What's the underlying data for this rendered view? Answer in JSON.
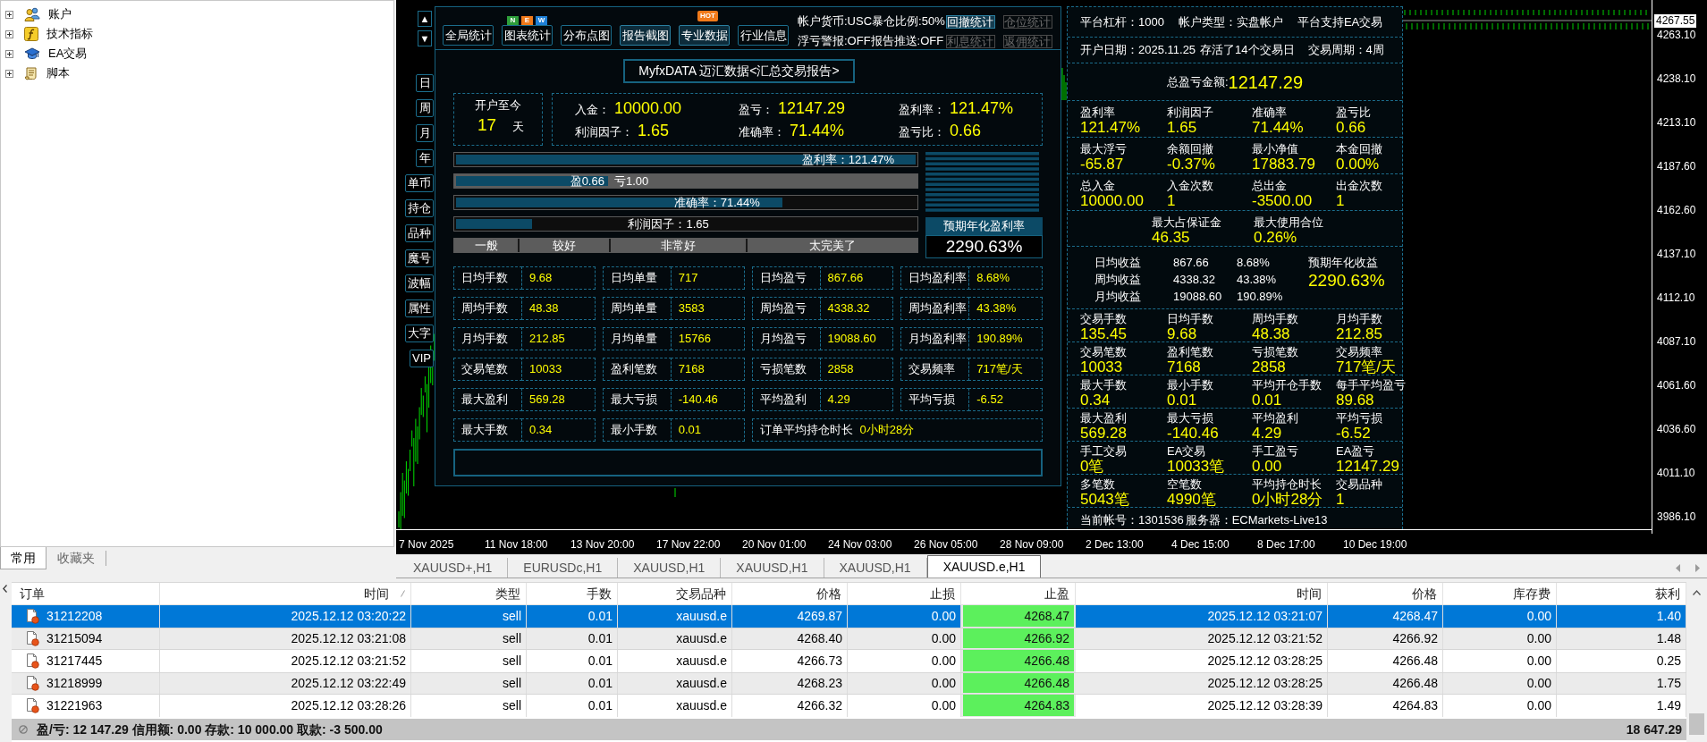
{
  "navigator": {
    "items": [
      {
        "label": "账户",
        "kind": "accounts",
        "expanded": false
      },
      {
        "label": "技术指标",
        "kind": "indicators",
        "expanded": false
      },
      {
        "label": "EA交易",
        "kind": "experts",
        "expanded": false
      },
      {
        "label": "脚本",
        "kind": "scripts",
        "expanded": false
      }
    ],
    "tabs": [
      {
        "label": "常用",
        "selected": true
      },
      {
        "label": "收藏夹",
        "selected": false
      }
    ]
  },
  "chart": {
    "current_price": "4267.55",
    "price_labels": [
      "4263.10",
      "4238.10",
      "4213.10",
      "4187.60",
      "4162.60",
      "4137.10",
      "4112.10",
      "4087.10",
      "4061.60",
      "4036.60",
      "4011.10",
      "3986.10"
    ],
    "time_labels": [
      "7 Nov 2025",
      "11 Nov 18:00",
      "13 Nov 20:00",
      "17 Nov 22:00",
      "20 Nov 01:00",
      "24 Nov 03:00",
      "26 Nov 05:00",
      "28 Nov 09:00",
      "2 Dec 13:00",
      "4 Dec 15:00",
      "8 Dec 17:00",
      "10 Dec 19:00"
    ],
    "tabs": [
      {
        "label": "XAUUSD+,H1",
        "selected": false
      },
      {
        "label": "EURUSDc,H1",
        "selected": false
      },
      {
        "label": "XAUUSD,H1",
        "selected": false
      },
      {
        "label": "XAUUSD,H1",
        "selected": false
      },
      {
        "label": "XAUUSD,H1",
        "selected": false
      },
      {
        "label": "XAUUSD.e,H1",
        "selected": true
      }
    ]
  },
  "report_panel": {
    "scroll_buttons": [
      "▲",
      "▼"
    ],
    "side_buttons": [
      "日",
      "周",
      "月",
      "年",
      "单币",
      "持仓",
      "品种",
      "魔号",
      "波幅",
      "属性",
      "大字",
      "VIP"
    ],
    "toolbar": [
      {
        "label": "全局统计",
        "highlighted": false
      },
      {
        "label": "图表统计",
        "highlighted": false,
        "badge": {
          "kind": "tiles",
          "letters": [
            {
              "text": "N",
              "color": "#2e9e3a"
            },
            {
              "text": "E",
              "color": "#f07a1a"
            },
            {
              "text": "W",
              "color": "#1e7fd6"
            }
          ]
        }
      },
      {
        "label": "分布点图",
        "highlighted": false
      },
      {
        "label": "报告截图",
        "highlighted": true
      },
      {
        "label": "专业数据",
        "highlighted": true,
        "badge": {
          "kind": "bubble",
          "text": "HOT"
        }
      },
      {
        "label": "行业信息",
        "highlighted": false
      }
    ],
    "status_lines": [
      "帐户货币:USC暴仓比例:50%",
      "浮亏警报:OFF报告推送:OFF"
    ],
    "stat_buttons": [
      {
        "label": "回撤统计",
        "disabled": false
      },
      {
        "label": "仓位统计",
        "disabled": true
      },
      {
        "label": "利息统计",
        "disabled": true
      },
      {
        "label": "返佣统计",
        "disabled": true
      }
    ],
    "title": "MyfxDATA 迈汇数据<汇总交易报告>",
    "since_open": {
      "label": "开户至今",
      "days": "17",
      "unit": "天"
    },
    "summary": [
      {
        "label": "入金：",
        "value": "10000.00"
      },
      {
        "label": "盈亏：",
        "value": "12147.29"
      },
      {
        "label": "盈利率：",
        "value": "121.47%"
      },
      {
        "label": "利润因子：",
        "value": "1.65"
      },
      {
        "label": "准确率：",
        "value": "71.44%"
      },
      {
        "label": "盈亏比：",
        "value": "0.66"
      }
    ],
    "bars": [
      {
        "kind": "single",
        "text": "盈利率：121.47%",
        "level": 1
      },
      {
        "kind": "split",
        "left_text": "盈0.66",
        "right_text": "亏1.00",
        "level": 0.33
      },
      {
        "kind": "single",
        "text": "准确率：71.44%",
        "level": 0.71
      },
      {
        "kind": "single",
        "text": "利润因子：1.65",
        "level": 0.165
      }
    ],
    "rating_scale": [
      "一般",
      "较好",
      "非常好",
      "太完美了"
    ],
    "forecast": {
      "label": "预期年化盈利率",
      "value": "2290.63%"
    },
    "metrics": [
      [
        {
          "kind": "pair",
          "label": "日均手数",
          "value": "9.68"
        },
        {
          "kind": "pair",
          "label": "日均单量",
          "value": "717"
        },
        {
          "kind": "pair",
          "label": "日均盈亏",
          "value": "867.66"
        },
        {
          "kind": "pair",
          "label": "日均盈利率",
          "value": "8.68%"
        }
      ],
      [
        {
          "kind": "pair",
          "label": "周均手数",
          "value": "48.38"
        },
        {
          "kind": "pair",
          "label": "周均单量",
          "value": "3583"
        },
        {
          "kind": "pair",
          "label": "周均盈亏",
          "value": "4338.32"
        },
        {
          "kind": "pair",
          "label": "周均盈利率",
          "value": "43.38%"
        }
      ],
      [
        {
          "kind": "pair",
          "label": "月均手数",
          "value": "212.85"
        },
        {
          "kind": "pair",
          "label": "月均单量",
          "value": "15766"
        },
        {
          "kind": "pair",
          "label": "月均盈亏",
          "value": "19088.60"
        },
        {
          "kind": "pair",
          "label": "月均盈利率",
          "value": "190.89%"
        }
      ],
      [
        {
          "kind": "pair",
          "label": "交易笔数",
          "value": "10033"
        },
        {
          "kind": "pair",
          "label": "盈利笔数",
          "value": "7168"
        },
        {
          "kind": "pair",
          "label": "亏损笔数",
          "value": "2858"
        },
        {
          "kind": "pair",
          "label": "交易频率",
          "value": "717笔/天"
        }
      ],
      [
        {
          "kind": "pair",
          "label": "最大盈利",
          "value": "569.28"
        },
        {
          "kind": "pair",
          "label": "最大亏损",
          "value": "-140.46"
        },
        {
          "kind": "pair",
          "label": "平均盈利",
          "value": "4.29"
        },
        {
          "kind": "pair",
          "label": "平均亏损",
          "value": "-6.52"
        }
      ],
      [
        {
          "kind": "pair",
          "label": "最大手数",
          "value": "0.34"
        },
        {
          "kind": "pair",
          "label": "最小手数",
          "value": "0.01"
        },
        {
          "kind": "wide",
          "label": "订单平均持仓时长",
          "value": "0小时28分"
        }
      ]
    ]
  },
  "summary_panel": {
    "info": [
      "平台杠杆：1000",
      "帐户类型：实盘帐户",
      "平台支持EA交易"
    ],
    "period": [
      "开户日期：2025.11.25",
      "存活了14个交易日",
      "交易周期：4周"
    ],
    "total": {
      "label": "总盈亏金额:",
      "value": "12147.29"
    },
    "ratio_rows": [
      [
        {
          "label": "盈利率",
          "value": "121.47%"
        },
        {
          "label": "利润因子",
          "value": "1.65"
        },
        {
          "label": "准确率",
          "value": "71.44%"
        },
        {
          "label": "盈亏比",
          "value": "0.66"
        }
      ],
      [
        {
          "label": "最大浮亏",
          "value": "-65.87"
        },
        {
          "label": "余额回撤",
          "value": "-0.37%"
        },
        {
          "label": "最小净值",
          "value": "17883.79"
        },
        {
          "label": "本金回撤",
          "value": "0.00%"
        }
      ],
      [
        {
          "label": "总入金",
          "value": "10000.00"
        },
        {
          "label": "入金次数",
          "value": "1"
        },
        {
          "label": "总出金",
          "value": "-3500.00"
        },
        {
          "label": "出金次数",
          "value": "1"
        }
      ]
    ],
    "margin_row": [
      {
        "label": "最大占保证金",
        "value": "46.35"
      },
      {
        "label": "最大使用合位",
        "value": "0.26%"
      }
    ],
    "averages": [
      {
        "label": "日均收益",
        "value": "867.66",
        "percent": "8.68%"
      },
      {
        "label": "周均收益",
        "value": "4338.32",
        "percent": "43.38%"
      },
      {
        "label": "月均收益",
        "value": "19088.60",
        "percent": "190.89%"
      }
    ],
    "annual": {
      "label": "预期年化收益",
      "value": "2290.63%"
    },
    "detail_rows": [
      [
        {
          "label": "交易手数",
          "value": "135.45"
        },
        {
          "label": "日均手数",
          "value": "9.68"
        },
        {
          "label": "周均手数",
          "value": "48.38"
        },
        {
          "label": "月均手数",
          "value": "212.85"
        }
      ],
      [
        {
          "label": "交易笔数",
          "value": "10033"
        },
        {
          "label": "盈利笔数",
          "value": "7168"
        },
        {
          "label": "亏损笔数",
          "value": "2858"
        },
        {
          "label": "交易频率",
          "value": "717笔/天"
        }
      ],
      [
        {
          "label": "最大手数",
          "value": "0.34"
        },
        {
          "label": "最小手数",
          "value": "0.01"
        },
        {
          "label": "平均开仓手数",
          "value": "0.01"
        },
        {
          "label": "每手平均盈亏",
          "value": "89.68"
        }
      ],
      [
        {
          "label": "最大盈利",
          "value": "569.28"
        },
        {
          "label": "最大亏损",
          "value": "-140.46"
        },
        {
          "label": "平均盈利",
          "value": "4.29"
        },
        {
          "label": "平均亏损",
          "value": "-6.52"
        }
      ],
      [
        {
          "label": "手工交易",
          "value": "0笔"
        },
        {
          "label": "EA交易",
          "value": "10033笔"
        },
        {
          "label": "手工盈亏",
          "value": "0.00"
        },
        {
          "label": "EA盈亏",
          "value": "12147.29"
        }
      ],
      [
        {
          "label": "多笔数",
          "value": "5043笔"
        },
        {
          "label": "空笔数",
          "value": "4990笔"
        },
        {
          "label": "平均持仓时长",
          "value": "0小时28分"
        },
        {
          "label": "交易品种",
          "value": "1"
        }
      ]
    ],
    "account": {
      "number": "当前帐号：1301536",
      "server": "服务器：ECMarkets-Live13"
    }
  },
  "table": {
    "columns": [
      {
        "label": "订单",
        "sorted": false,
        "highlighted": false
      },
      {
        "label": "时间",
        "sorted": true,
        "highlighted": false
      },
      {
        "label": "类型",
        "sorted": false,
        "highlighted": false
      },
      {
        "label": "手数",
        "sorted": false,
        "highlighted": false
      },
      {
        "label": "交易品种",
        "sorted": false,
        "highlighted": false
      },
      {
        "label": "价格",
        "sorted": false,
        "highlighted": false
      },
      {
        "label": "止损",
        "sorted": false,
        "highlighted": false
      },
      {
        "label": "止盈",
        "sorted": false,
        "highlighted": true
      },
      {
        "label": "时间",
        "sorted": false,
        "highlighted": false
      },
      {
        "label": "价格",
        "sorted": false,
        "highlighted": false
      },
      {
        "label": "库存费",
        "sorted": false,
        "highlighted": false
      },
      {
        "label": "获利",
        "sorted": false,
        "highlighted": false
      }
    ],
    "rows": [
      {
        "selected": true,
        "cells": [
          "31212208",
          "2025.12.12 03:20:22",
          "sell",
          "0.01",
          "xauusd.e",
          "4269.87",
          "0.00",
          "4268.47",
          "2025.12.12 03:21:07",
          "4268.47",
          "0.00",
          "1.40"
        ]
      },
      {
        "selected": false,
        "cells": [
          "31215094",
          "2025.12.12 03:21:08",
          "sell",
          "0.01",
          "xauusd.e",
          "4268.40",
          "0.00",
          "4266.92",
          "2025.12.12 03:21:52",
          "4266.92",
          "0.00",
          "1.48"
        ]
      },
      {
        "selected": false,
        "cells": [
          "31217445",
          "2025.12.12 03:21:52",
          "sell",
          "0.01",
          "xauusd.e",
          "4266.73",
          "0.00",
          "4266.48",
          "2025.12.12 03:28:25",
          "4266.48",
          "0.00",
          "0.25"
        ]
      },
      {
        "selected": false,
        "cells": [
          "31218999",
          "2025.12.12 03:22:49",
          "sell",
          "0.01",
          "xauusd.e",
          "4268.23",
          "0.00",
          "4266.48",
          "2025.12.12 03:28:25",
          "4266.48",
          "0.00",
          "1.75"
        ]
      },
      {
        "selected": false,
        "cells": [
          "31221963",
          "2025.12.12 03:28:26",
          "sell",
          "0.01",
          "xauusd.e",
          "4266.32",
          "0.00",
          "4264.83",
          "2025.12.12 03:28:39",
          "4264.83",
          "0.00",
          "1.49"
        ]
      }
    ],
    "footer": {
      "summary": "盈/亏: 12 147.29 信用额: 0.00 存款: 10 000.00 取款: -3 500.00",
      "total": "18 647.29"
    }
  }
}
